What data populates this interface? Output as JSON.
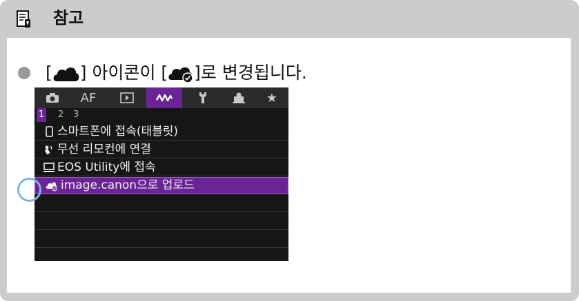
{
  "note": {
    "title": "참고",
    "icon": "note-icon"
  },
  "bullet": {
    "text_before": "[",
    "text_middle": "] 아이콘이 [",
    "text_after": "]로 변경됩니다.",
    "icon_old": "cloud-icon",
    "icon_new": "cloud-check-icon"
  },
  "camera_menu": {
    "tabs": [
      {
        "icon": "camera-icon",
        "label": ""
      },
      {
        "icon": "af-text",
        "label": "AF"
      },
      {
        "icon": "play-icon",
        "label": ""
      },
      {
        "icon": "wireless-icon",
        "label": ""
      },
      {
        "icon": "wrench-icon",
        "label": ""
      },
      {
        "icon": "custom-icon",
        "label": ""
      },
      {
        "icon": "star-icon",
        "label": "★"
      }
    ],
    "active_tab": 3,
    "pages": [
      "1",
      "2",
      "3"
    ],
    "current_page": "1",
    "items": [
      {
        "icon": "smartphone-icon",
        "label": "스마트폰에 접속(태블릿)"
      },
      {
        "icon": "remote-icon",
        "label": "무선 리모컨에 연결"
      },
      {
        "icon": "computer-icon",
        "label": "EOS Utility에 접속"
      },
      {
        "icon": "cloud-check-icon",
        "label": "image.canon으로 업로드"
      }
    ],
    "selected_item": 3,
    "colors": {
      "accent": "#6b2496",
      "highlight_ring": "#7db3e8"
    }
  }
}
